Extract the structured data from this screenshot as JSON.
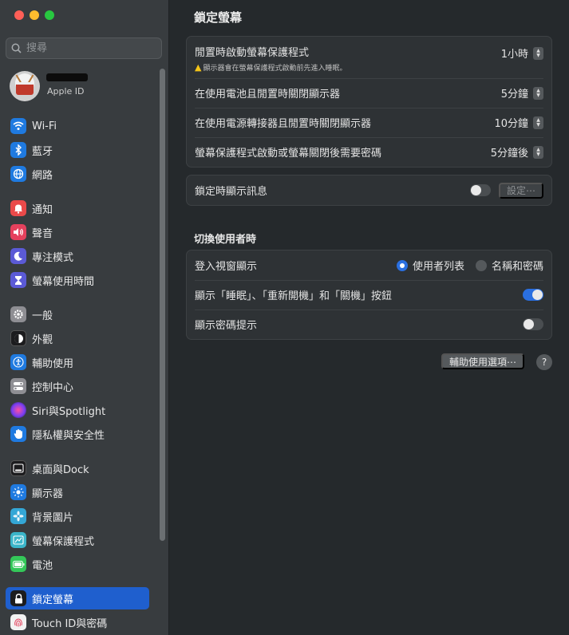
{
  "search": {
    "placeholder": "搜尋"
  },
  "profile": {
    "subtitle": "Apple ID"
  },
  "sidebar": {
    "items": [
      {
        "label": "Wi-Fi",
        "icon": "wifi-icon",
        "color": "#1f7ae0"
      },
      {
        "label": "藍牙",
        "icon": "bluetooth-icon",
        "color": "#1f7ae0"
      },
      {
        "label": "網路",
        "icon": "globe-icon",
        "color": "#1f7ae0"
      },
      {
        "label": "通知",
        "icon": "bell-icon",
        "color": "#ea4a4a"
      },
      {
        "label": "聲音",
        "icon": "speaker-icon",
        "color": "#e5415d"
      },
      {
        "label": "專注模式",
        "icon": "moon-icon",
        "color": "#5b5ad6"
      },
      {
        "label": "螢幕使用時間",
        "icon": "hourglass-icon",
        "color": "#5b5ad6"
      },
      {
        "label": "一般",
        "icon": "gear-icon",
        "color": "#8e8e93"
      },
      {
        "label": "外觀",
        "icon": "appearance-icon",
        "color": "#1c1c1e"
      },
      {
        "label": "輔助使用",
        "icon": "accessibility-icon",
        "color": "#1f7ae0"
      },
      {
        "label": "控制中心",
        "icon": "control-center-icon",
        "color": "#8e8e93"
      },
      {
        "label": "Siri與Spotlight",
        "icon": "siri-icon",
        "color": "#8a4de0"
      },
      {
        "label": "隱私權與安全性",
        "icon": "hand-icon",
        "color": "#1f7ae0"
      },
      {
        "label": "桌面與Dock",
        "icon": "dock-icon",
        "color": "#1c1c1e"
      },
      {
        "label": "顯示器",
        "icon": "display-icon",
        "color": "#1f7ae0"
      },
      {
        "label": "背景圖片",
        "icon": "wallpaper-icon",
        "color": "#34a7d6"
      },
      {
        "label": "螢幕保護程式",
        "icon": "screensaver-icon",
        "color": "#3bb5c9"
      },
      {
        "label": "電池",
        "icon": "battery-icon",
        "color": "#34c759"
      },
      {
        "label": "鎖定螢幕",
        "icon": "lock-icon",
        "color": "#1c1c1e"
      },
      {
        "label": "Touch ID與密碼",
        "icon": "fingerprint-icon",
        "color": "#f2f2f2"
      }
    ]
  },
  "main": {
    "title": "鎖定螢幕",
    "group1": {
      "screensaver_label": "閒置時啟動螢幕保護程式",
      "screensaver_warning": "顯示器會在螢幕保護程式啟動前先進入睡眠。",
      "screensaver_value": "1小時",
      "battery_label": "在使用電池且閒置時關閉顯示器",
      "battery_value": "5分鐘",
      "adapter_label": "在使用電源轉接器且閒置時關閉顯示器",
      "adapter_value": "10分鐘",
      "password_label": "螢幕保護程式啟動或螢幕關閉後需要密碼",
      "password_value": "5分鐘後"
    },
    "group2": {
      "message_label": "鎖定時顯示訊息",
      "message_toggle": false,
      "settings_button": "設定⋯"
    },
    "switch_section_title": "切換使用者時",
    "group3": {
      "login_window_label": "登入視窗顯示",
      "option_list": "使用者列表",
      "option_name": "名稱和密碼",
      "selected": "使用者列表",
      "buttons_label": "顯示「睡眠」、「重新開機」和「關機」按鈕",
      "buttons_toggle": true,
      "hint_label": "顯示密碼提示",
      "hint_toggle": false
    },
    "accessibility_button": "輔助使用選項⋯",
    "help": "?"
  },
  "colors": {
    "accent": "#2a6fe0",
    "active_sidebar": "#1f5fce"
  }
}
